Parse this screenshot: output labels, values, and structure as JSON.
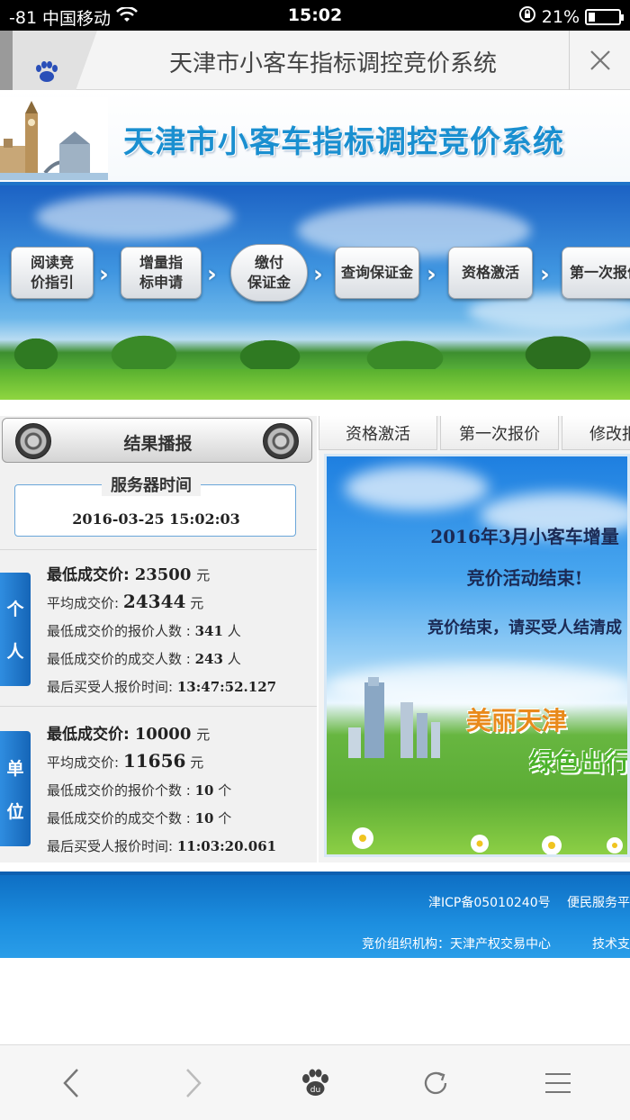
{
  "status_bar": {
    "signal": "-81",
    "carrier": "中国移动",
    "time": "15:02",
    "battery": "21%",
    "battery_level": 0.21
  },
  "browser": {
    "title": "天津市小客车指标调控竞价系统"
  },
  "site": {
    "title": "天津市小客车指标调控竞价系统"
  },
  "steps": [
    {
      "line1": "阅读竞",
      "line2": "价指引"
    },
    {
      "line1": "增量指",
      "line2": "标申请"
    },
    {
      "line1": "缴付",
      "line2": "保证金"
    },
    {
      "line1": "查询保证金",
      "line2": ""
    },
    {
      "line1": "资格激活",
      "line2": ""
    },
    {
      "line1": "第一次报价",
      "line2": ""
    }
  ],
  "results": {
    "header": "结果播报",
    "server_time_label": "服务器时间",
    "server_time": "2016-03-25 15:02:03",
    "individual": {
      "tab_char1": "个",
      "tab_char2": "人",
      "min_price_label": "最低成交价:",
      "min_price": "23500",
      "min_price_unit": "元",
      "avg_price_label": "平均成交价:",
      "avg_price": "24344",
      "avg_price_unit": "元",
      "bidders_label": "最低成交价的报价人数 :",
      "bidders": "341",
      "bidders_unit": "人",
      "deals_label": "最低成交价的成交人数 :",
      "deals": "243",
      "deals_unit": "人",
      "last_time_label": "最后买受人报价时间:",
      "last_time": "13:47:52.127"
    },
    "company": {
      "tab_char1": "单",
      "tab_char2": "位",
      "min_price_label": "最低成交价:",
      "min_price": "10000",
      "min_price_unit": "元",
      "avg_price_label": "平均成交价:",
      "avg_price": "11656",
      "avg_price_unit": "元",
      "bidders_label": "最低成交价的报价个数 :",
      "bidders": "10",
      "bidders_unit": "个",
      "deals_label": "最低成交价的成交个数 :",
      "deals": "10",
      "deals_unit": "个",
      "last_time_label": "最后买受人报价时间:",
      "last_time": "11:03:20.061"
    }
  },
  "tabs": [
    "资格激活",
    "第一次报价",
    "修改报"
  ],
  "notice": {
    "line1": "2016年3月小客车增量",
    "line2": "竞价活动结束!",
    "line3": "竞价结束，请买受人结清成",
    "slogan1": "美丽天津",
    "slogan2": "绿色出行"
  },
  "footer": {
    "icp": "津ICP备05010240号",
    "service": "便民服务平",
    "organizer": "竞价组织机构：天津产权交易中心",
    "tech": "技术支"
  },
  "colors": {
    "brand_blue": "#1f73c8",
    "title_blue": "#1a8fd0"
  }
}
